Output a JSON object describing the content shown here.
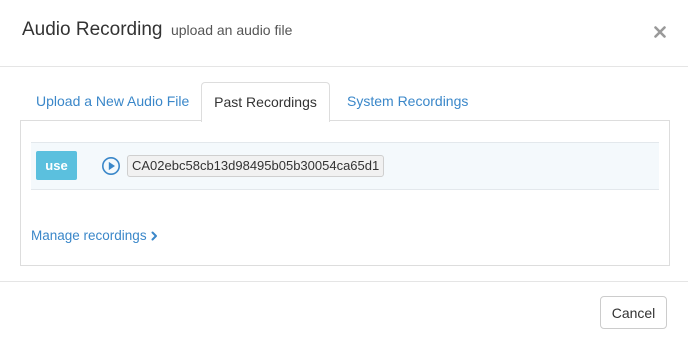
{
  "header": {
    "title": "Audio Recording",
    "subtitle": "upload an audio file",
    "close_icon": "close-icon"
  },
  "tabs": [
    {
      "label": "Upload a New Audio File",
      "active": false
    },
    {
      "label": "Past Recordings",
      "active": true
    },
    {
      "label": "System Recordings",
      "active": false
    }
  ],
  "recordings": [
    {
      "use_label": "use",
      "play_icon": "play-circle-icon",
      "id": "CA02ebc58cb13d98495b05b30054ca65d1"
    }
  ],
  "manage_link": {
    "label": "Manage recordings",
    "icon": "chevron-right-icon"
  },
  "footer": {
    "cancel_label": "Cancel"
  },
  "colors": {
    "link": "#3a87c9",
    "use_button": "#5bc0de",
    "row_background": "#f4f9fc"
  }
}
